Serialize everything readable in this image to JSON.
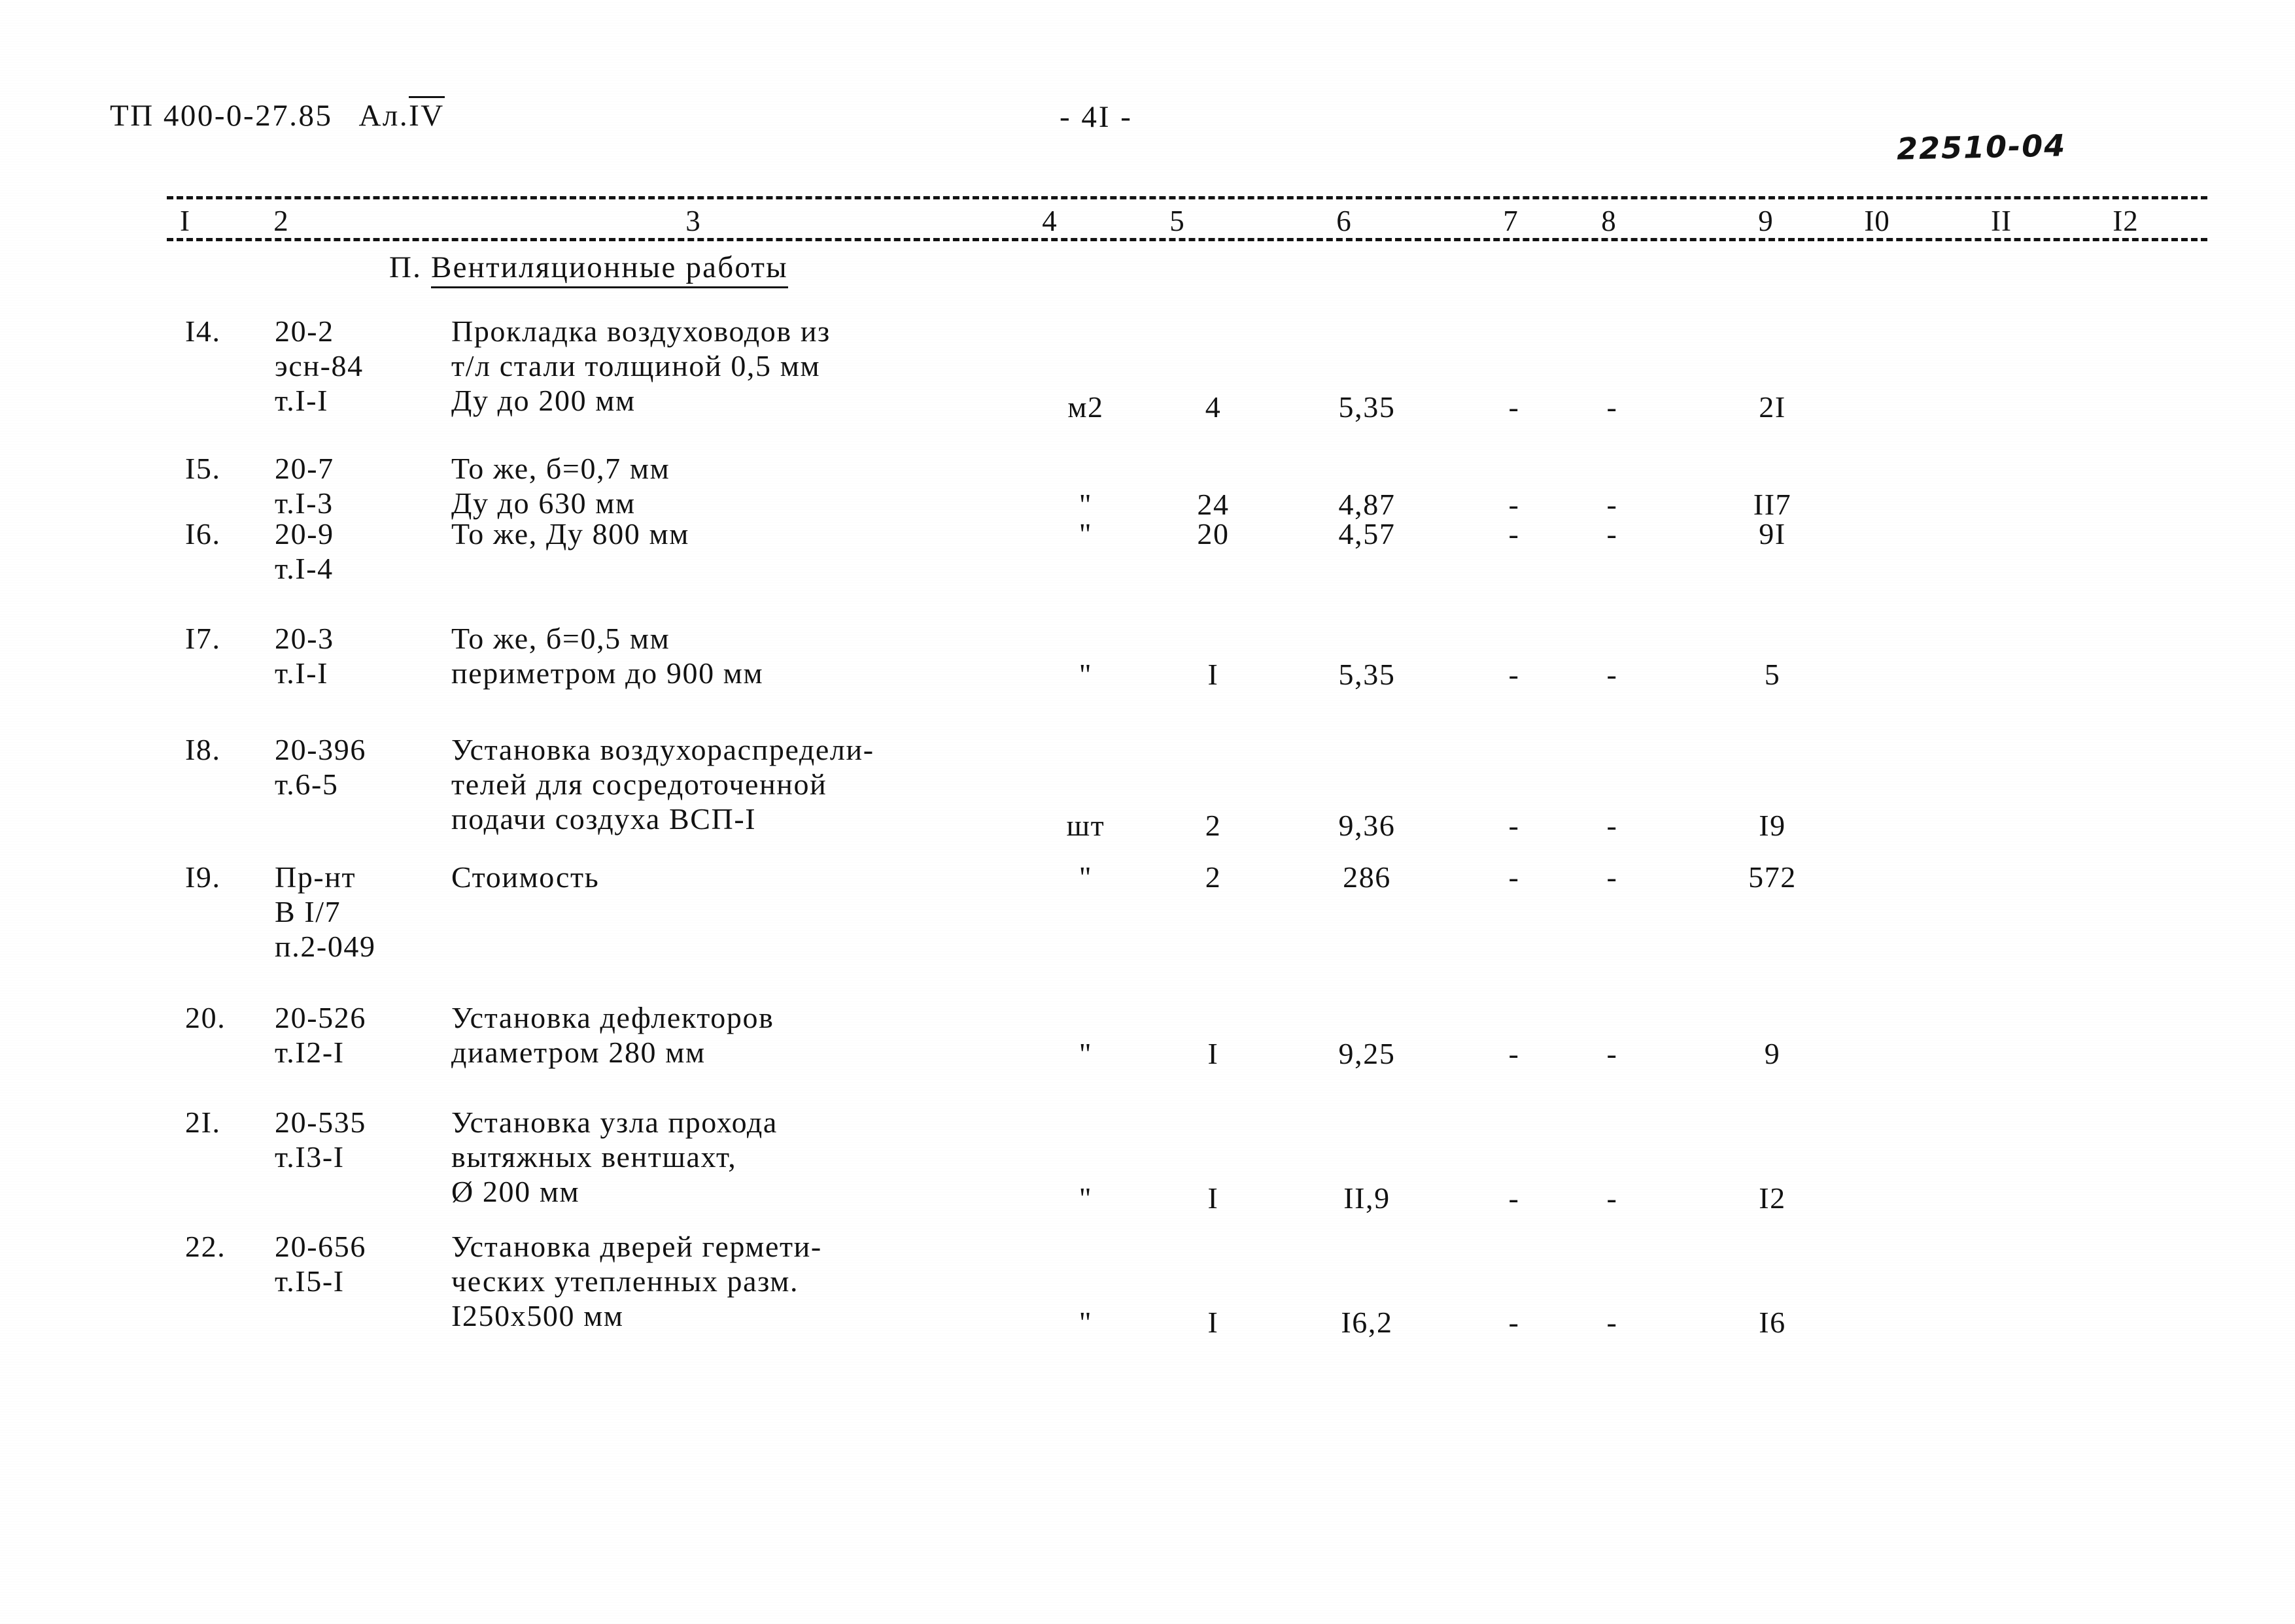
{
  "header": {
    "doc_code": "ТП 400-0-27.85",
    "album_label": "Ал.",
    "album_number": "IV",
    "page_marker": "- 4I -",
    "stamp": "22510-04"
  },
  "table": {
    "column_numbers": [
      "I",
      "2",
      "3",
      "4",
      "5",
      "6",
      "7",
      "8",
      "9",
      "I0",
      "II",
      "I2"
    ],
    "section_title_prefix": "П.",
    "section_title": "Вентиляционные работы",
    "rows": [
      {
        "num": "I4.",
        "basis": [
          "20-2",
          "эсн-84",
          "т.I-I"
        ],
        "name": [
          "Прокладка воздуховодов из",
          "т/л стали толщиной 0,5 мм",
          "Ду до 200 мм"
        ],
        "unit": "м2",
        "qty": "4",
        "price": "5,35",
        "col7": "-",
        "col8": "-",
        "total": "2I"
      },
      {
        "num": "I5.",
        "basis": [
          "20-7",
          "т.I-3"
        ],
        "name": [
          "То же, б=0,7 мм",
          "Ду до 630 мм"
        ],
        "unit": "\"",
        "qty": "24",
        "price": "4,87",
        "col7": "-",
        "col8": "-",
        "total": "II7"
      },
      {
        "num": "I6.",
        "basis": [
          "20-9",
          "т.I-4"
        ],
        "name": [
          "То же, Ду 800 мм"
        ],
        "unit": "\"",
        "qty": "20",
        "price": "4,57",
        "col7": "-",
        "col8": "-",
        "total": "9I"
      },
      {
        "num": "I7.",
        "basis": [
          "20-3",
          "т.I-I"
        ],
        "name": [
          "То же, б=0,5 мм",
          "периметром до 900 мм"
        ],
        "unit": "\"",
        "qty": "I",
        "price": "5,35",
        "col7": "-",
        "col8": "-",
        "total": "5"
      },
      {
        "num": "I8.",
        "basis": [
          "20-396",
          "т.6-5"
        ],
        "name": [
          "Установка воздухораспредели-",
          "телей для сосредоточенной",
          "подачи создуха ВСП-I"
        ],
        "unit": "шт",
        "qty": "2",
        "price": "9,36",
        "col7": "-",
        "col8": "-",
        "total": "I9"
      },
      {
        "num": "I9.",
        "basis": [
          "Пр-нт",
          "В I/7",
          "п.2-049"
        ],
        "name": [
          "Стоимость"
        ],
        "unit": "\"",
        "qty": "2",
        "price": "286",
        "col7": "-",
        "col8": "-",
        "total": "572"
      },
      {
        "num": "20.",
        "basis": [
          "20-526",
          "т.I2-I"
        ],
        "name": [
          "Установка дефлекторов",
          "диаметром 280 мм"
        ],
        "unit": "\"",
        "qty": "I",
        "price": "9,25",
        "col7": "-",
        "col8": "-",
        "total": "9"
      },
      {
        "num": "2I.",
        "basis": [
          "20-535",
          "т.I3-I"
        ],
        "name": [
          "Установка узла прохода",
          "вытяжных вентшахт,",
          "Ø 200 мм"
        ],
        "unit": "\"",
        "qty": "I",
        "price": "II,9",
        "col7": "-",
        "col8": "-",
        "total": "I2"
      },
      {
        "num": "22.",
        "basis": [
          "20-656",
          "т.I5-I"
        ],
        "name": [
          "Установка дверей гермети-",
          "ческих утепленных разм.",
          "I250х500 мм"
        ],
        "unit": "\"",
        "qty": "I",
        "price": "I6,2",
        "col7": "-",
        "col8": "-",
        "total": "I6"
      }
    ]
  },
  "layout": {
    "column_number_x": [
      283,
      430,
      1060,
      1605,
      1800,
      2055,
      2310,
      2460,
      2700,
      2870,
      3060,
      3250
    ],
    "row_tops": [
      480,
      690,
      790,
      950,
      1120,
      1315,
      1530,
      1690,
      1880
    ],
    "row_value_offsets": [
      116,
      55,
      0,
      55,
      116,
      0,
      55,
      116,
      116
    ]
  }
}
